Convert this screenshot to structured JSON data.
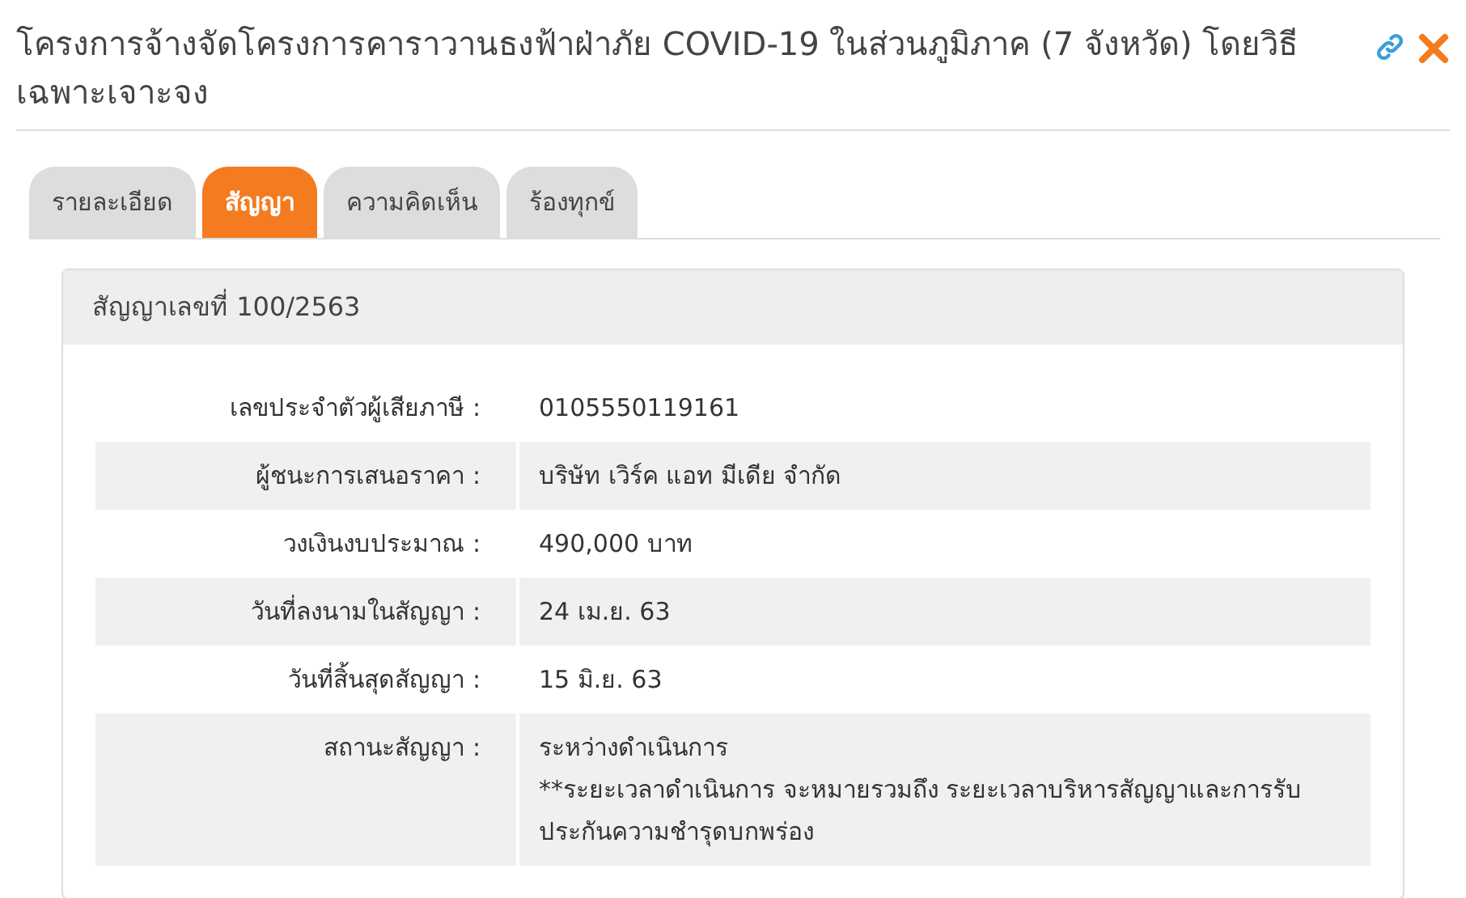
{
  "title": "โครงการจ้างจัดโครงการคาราวานธงฟ้าฝ่าภัย COVID-19 ในส่วนภูมิภาค (7 จังหวัด) โดยวิธีเฉพาะเจาะจง",
  "tabs": [
    {
      "label": "รายละเอียด",
      "selected": false
    },
    {
      "label": "สัญญา",
      "selected": true
    },
    {
      "label": "ความคิดเห็น",
      "selected": false
    },
    {
      "label": "ร้องทุกข์",
      "selected": false
    }
  ],
  "card": {
    "heading": "สัญญาเลขที่ 100/2563",
    "rows": [
      {
        "label": "เลขประจำตัวผู้เสียภาษี :",
        "value": "0105550119161"
      },
      {
        "label": "ผู้ชนะการเสนอราคา :",
        "value": "บริษัท เวิร์ค แอท มีเดีย จำกัด"
      },
      {
        "label": "วงเงินงบประมาณ :",
        "value": "490,000 บาท"
      },
      {
        "label": "วันที่ลงนามในสัญญา :",
        "value": "24 เม.ย. 63"
      },
      {
        "label": "วันที่สิ้นสุดสัญญา :",
        "value": "15 มิ.ย. 63"
      },
      {
        "label": "สถานะสัญญา :",
        "value": "ระหว่างดำเนินการ",
        "note": "**ระยะเวลาดำเนินการ จะหมายรวมถึง ระยะเวลาบริหารสัญญาและการรับประกันความชำรุดบกพร่อง"
      }
    ]
  }
}
